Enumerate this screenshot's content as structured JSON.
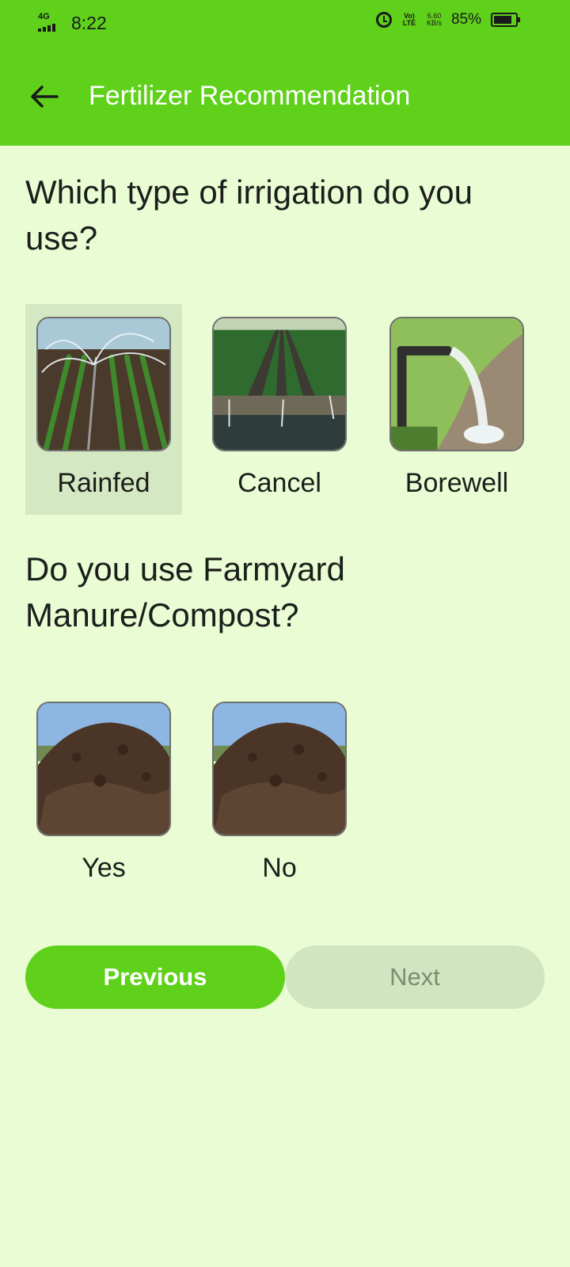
{
  "status_bar": {
    "network": "4G",
    "time": "8:22",
    "volte": "Vo) LTE",
    "speed_value": "6.60",
    "speed_unit": "KB/s",
    "battery": "85%",
    "battery_level": 0.85
  },
  "app_bar": {
    "title": "Fertilizer Recommendation",
    "back_icon": "arrow-left-icon"
  },
  "questions": [
    {
      "text": "Which type of irrigation do you use?",
      "options": [
        {
          "label": "Rainfed",
          "selected": true,
          "image": "sprinkler-field"
        },
        {
          "label": "Cancel",
          "selected": false,
          "image": "canal-field"
        },
        {
          "label": "Borewell",
          "selected": false,
          "image": "borewell-pipe"
        }
      ]
    },
    {
      "text": "Do you use Farmyard Manure/Compost?",
      "options": [
        {
          "label": "Yes",
          "selected": false,
          "image": "compost-pile"
        },
        {
          "label": "No",
          "selected": false,
          "image": "compost-pile"
        }
      ]
    }
  ],
  "buttons": {
    "previous": "Previous",
    "next": "Next",
    "next_enabled": false
  },
  "colors": {
    "primary": "#5fd11a",
    "background": "#e9fcd3",
    "selected_bg": "#d5e8c4",
    "disabled_bg": "#d1e5c0",
    "disabled_text": "#7c8d74"
  }
}
